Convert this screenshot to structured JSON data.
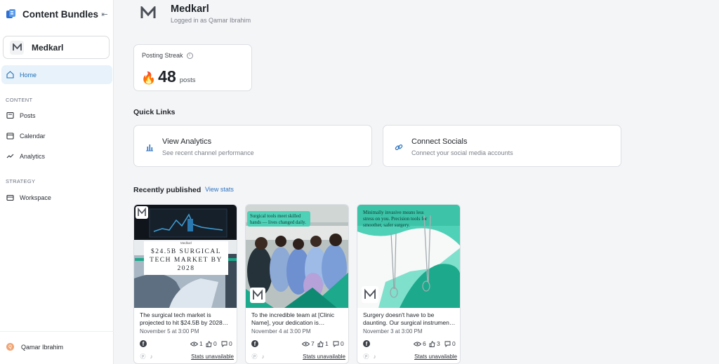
{
  "sidebar": {
    "brand_title": "Content Bundles",
    "account_name": "Medkarl",
    "nav": {
      "home": "Home",
      "content_section": "CONTENT",
      "posts": "Posts",
      "calendar": "Calendar",
      "analytics": "Analytics",
      "strategy_section": "STRATEGY",
      "workspace": "Workspace"
    },
    "user_name": "Qamar Ibrahim"
  },
  "header": {
    "workspace_name": "Medkarl",
    "logged_in_text": "Logged in as Qamar Ibrahim"
  },
  "streak": {
    "label": "Posting Streak",
    "value": "48",
    "unit": "posts"
  },
  "quick_links": {
    "title": "Quick Links",
    "items": [
      {
        "title": "View Analytics",
        "subtitle": "See recent channel performance",
        "icon": "bar-chart-icon"
      },
      {
        "title": "Connect Socials",
        "subtitle": "Connect your social media accounts",
        "icon": "link-icon"
      }
    ]
  },
  "recent": {
    "title": "Recently published",
    "view_stats": "View stats",
    "posts": [
      {
        "image_brand": "Medkarl",
        "image_headline_1": "$24.5B SURGICAL",
        "image_headline_2": "TECH MARKET BY",
        "image_headline_3": "2028",
        "caption_1": "The surgical tech market is",
        "caption_2": "projected to hit $24.5B by 2028…",
        "date": "November 5 at 3:00 PM",
        "views": "1",
        "likes": "0",
        "comments": "0",
        "stats_status": "Stats unavailable"
      },
      {
        "image_headline_1": "Surgical tools meet skilled",
        "image_headline_2": "hands — lives changed daily.",
        "caption_1": "To the incredible team at [Clinic",
        "caption_2": "Name], your dedication is…",
        "date": "November 4 at 3:00 PM",
        "views": "7",
        "likes": "1",
        "comments": "0",
        "stats_status": "Stats unavailable"
      },
      {
        "image_headline_1": "Minimally invasive means less",
        "image_headline_2": "stress on you. Precision tools for",
        "image_headline_3": "smoother, safer surgery.",
        "caption_1": "Surgery doesn't have to be",
        "caption_2": "daunting. Our surgical instrumen…",
        "date": "November 3 at 3:00 PM",
        "views": "6",
        "likes": "3",
        "comments": "0",
        "stats_status": "Stats unavailable"
      }
    ]
  },
  "colors": {
    "accent": "#1d6fb8",
    "teal": "#1ca98c",
    "active_nav_bg": "#e8f2fb"
  }
}
